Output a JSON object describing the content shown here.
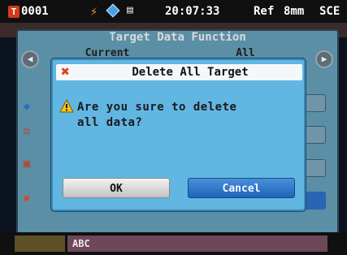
{
  "status_bar": {
    "target_badge": "T",
    "target_number": "0001",
    "time": "20:07:33",
    "ref": "Ref",
    "aperture": "8mm",
    "mode": "SCE"
  },
  "background": {
    "title": "Target Data Function",
    "tabs": [
      "Current",
      "All"
    ],
    "footer_text": "ABC"
  },
  "dialog": {
    "title": "Delete All Target",
    "message_line1": "Are you sure to delete",
    "message_line2": "all data?",
    "ok_label": "OK",
    "cancel_label": "Cancel"
  },
  "icons": {
    "status": [
      "target-icon",
      "lightning-icon",
      "diamond-icon",
      "monitor-icon"
    ],
    "side": [
      "diamond-icon",
      "tool-icon",
      "target-icon",
      "delete-x-icon"
    ],
    "dialog": [
      "delete-x-icon",
      "warning-icon"
    ]
  },
  "colors": {
    "dialog_bg": "#62b6e2",
    "ok_button": "#d0d0d0",
    "cancel_button": "#2a6fc3",
    "target_badge": "#d43a1a"
  }
}
